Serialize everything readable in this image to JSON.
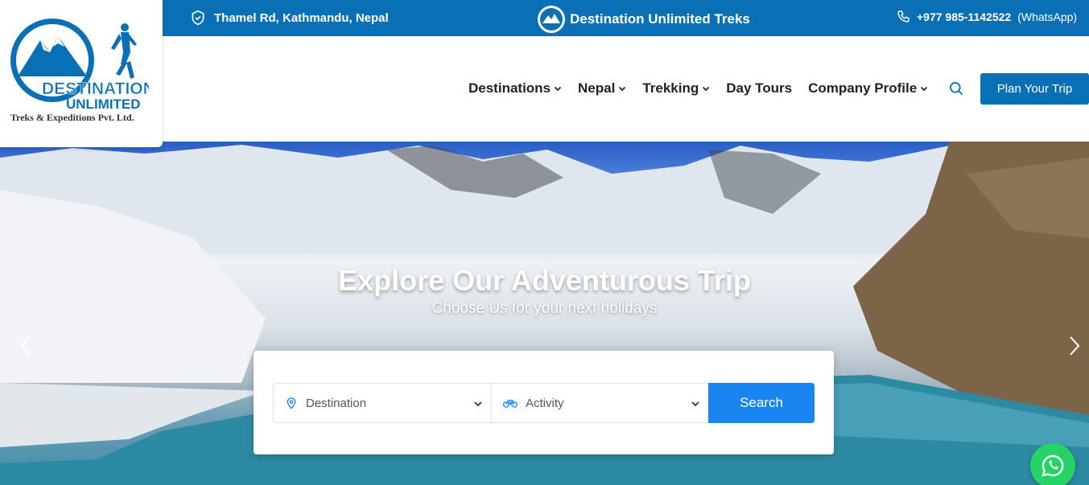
{
  "topbar": {
    "address": "Thamel Rd, Kathmandu, Nepal",
    "brand": "Destination Unlimited Treks",
    "phone": "+977 985-1142522",
    "whatsapp_label": "(WhatsApp)"
  },
  "logo": {
    "line1": "DESTINATION",
    "line2": "UNLIMITED",
    "tagline": "Treks & Expeditions Pvt. Ltd."
  },
  "nav": {
    "items": [
      {
        "label": "Destinations",
        "dropdown": true
      },
      {
        "label": "Nepal",
        "dropdown": true
      },
      {
        "label": "Trekking",
        "dropdown": true
      },
      {
        "label": "Day Tours",
        "dropdown": false
      },
      {
        "label": "Company Profile",
        "dropdown": true
      }
    ],
    "cta": "Plan Your Trip"
  },
  "hero": {
    "title": "Explore Our Adventurous Trip",
    "subtitle": "Choose Us for your next holidays"
  },
  "search": {
    "destination_placeholder": "Destination",
    "activity_placeholder": "Activity",
    "button": "Search"
  },
  "colors": {
    "primary": "#0a70b5",
    "search_button": "#1a85f0",
    "whatsapp": "#25d366"
  }
}
